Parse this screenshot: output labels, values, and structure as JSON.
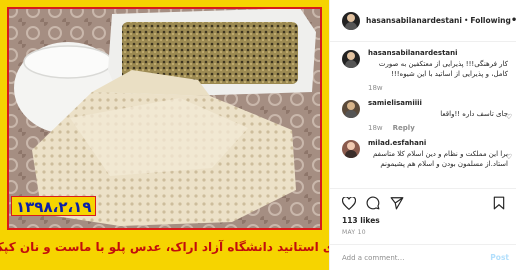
{
  "photo": {
    "date_stamp": "۱۳۹۸،۲،۱۹",
    "caption": "سحری استانید دانشگاه آزاد اراک، عدس پلو با ماست و نان کپک زده"
  },
  "header": {
    "username": "hasansabilanardestani",
    "separator": "•",
    "follow_label": "Following",
    "more_label": "•••"
  },
  "comments": [
    {
      "username": "hasansabilanardestani",
      "text": "کار فرهنگی!!! پذیرایی از معتکفین به صورت کامل، و پذیرایی از اساتید با این شیوه!!!",
      "time": "18w",
      "reply": ""
    },
    {
      "username": "samielisamiiii",
      "text": "جای تاسف داره !!واقعا",
      "time": "18w",
      "reply": "Reply"
    },
    {
      "username": "milad.esfahani",
      "text": "برا این مملکت و نظام و دین اسلام کلا متاسفم استاد.از مسلمون بودن و اسلام هم پشیمونم",
      "time": "",
      "reply": ""
    }
  ],
  "actions": {
    "likes": "113 likes",
    "date": "MAY 10"
  },
  "add_comment": {
    "placeholder": "Add a comment…",
    "post_label": "Post"
  },
  "colors": {
    "frame_yellow": "#f6d400",
    "frame_red": "#d81c1c",
    "caption_red": "#c20d0d",
    "date_blue": "#0b1fa8",
    "post_disabled": "#b2dffc",
    "muted": "#8e8e8e"
  }
}
